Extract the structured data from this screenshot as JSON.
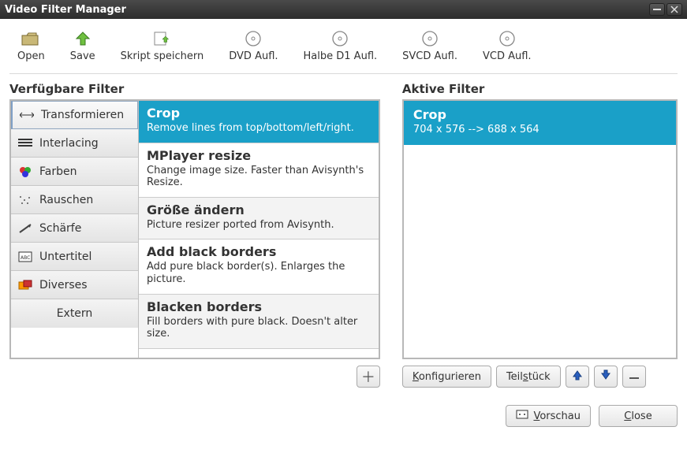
{
  "window": {
    "title": "Video Filter Manager"
  },
  "toolbar": {
    "open": "Open",
    "save": "Save",
    "skript": "Skript speichern",
    "dvd": "DVD Aufl.",
    "halbe": "Halbe D1 Aufl.",
    "svcd": "SVCD Aufl.",
    "vcd": "VCD Aufl."
  },
  "labels": {
    "available": "Verfügbare Filter",
    "active": "Aktive Filter",
    "extern": "Extern",
    "konfigurieren": "Konfigurieren",
    "teilstueck": "Teilstück",
    "vorschau": "Vorschau",
    "close": "Close",
    "plus": "+"
  },
  "categories": [
    {
      "label": "Transformieren",
      "icon": "transform"
    },
    {
      "label": "Interlacing",
      "icon": "interlace"
    },
    {
      "label": "Farben",
      "icon": "colors"
    },
    {
      "label": "Rauschen",
      "icon": "noise"
    },
    {
      "label": "Schärfe",
      "icon": "sharp"
    },
    {
      "label": "Untertitel",
      "icon": "subtitle"
    },
    {
      "label": "Diverses",
      "icon": "misc"
    }
  ],
  "filters": [
    {
      "name": "Crop",
      "desc": "Remove lines from top/bottom/left/right.",
      "selected": true
    },
    {
      "name": "MPlayer resize",
      "desc": "Change image size. Faster than Avisynth's Resize."
    },
    {
      "name": "Größe ändern",
      "desc": "Picture resizer ported from Avisynth."
    },
    {
      "name": "Add black borders",
      "desc": "Add pure black border(s). Enlarges the picture."
    },
    {
      "name": "Blacken borders",
      "desc": "Fill borders with pure black. Doesn't alter size."
    }
  ],
  "activeFilters": [
    {
      "name": "Crop",
      "desc": "704 x 576 --> 688 x 564"
    }
  ]
}
